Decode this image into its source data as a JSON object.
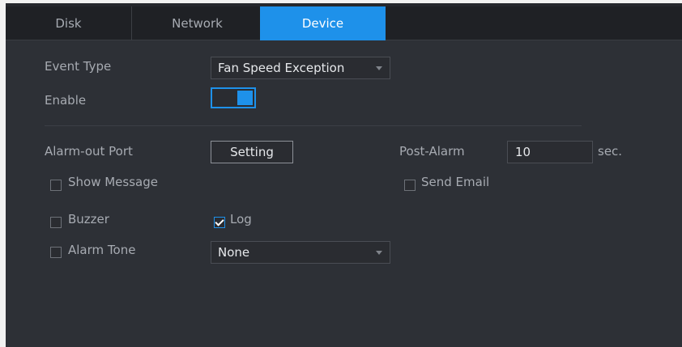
{
  "tabs": [
    {
      "label": "Disk"
    },
    {
      "label": "Network"
    },
    {
      "label": "Device"
    }
  ],
  "active_tab": "Device",
  "form": {
    "event_type_label": "Event Type",
    "event_type_value": "Fan Speed Exception",
    "enable_label": "Enable",
    "enable_on": true,
    "alarm_out_port_label": "Alarm-out Port",
    "setting_button": "Setting",
    "post_alarm_label": "Post-Alarm",
    "post_alarm_value": "10",
    "post_alarm_unit": "sec.",
    "show_message_label": "Show Message",
    "show_message_checked": false,
    "send_email_label": "Send Email",
    "send_email_checked": false,
    "buzzer_label": "Buzzer",
    "buzzer_checked": false,
    "log_label": "Log",
    "log_checked": true,
    "alarm_tone_label": "Alarm Tone",
    "alarm_tone_checked": false,
    "alarm_tone_value": "None"
  },
  "colors": {
    "accent": "#1e91ea",
    "panel_bg": "#2d3036",
    "tabbar_bg": "#1f2125"
  }
}
